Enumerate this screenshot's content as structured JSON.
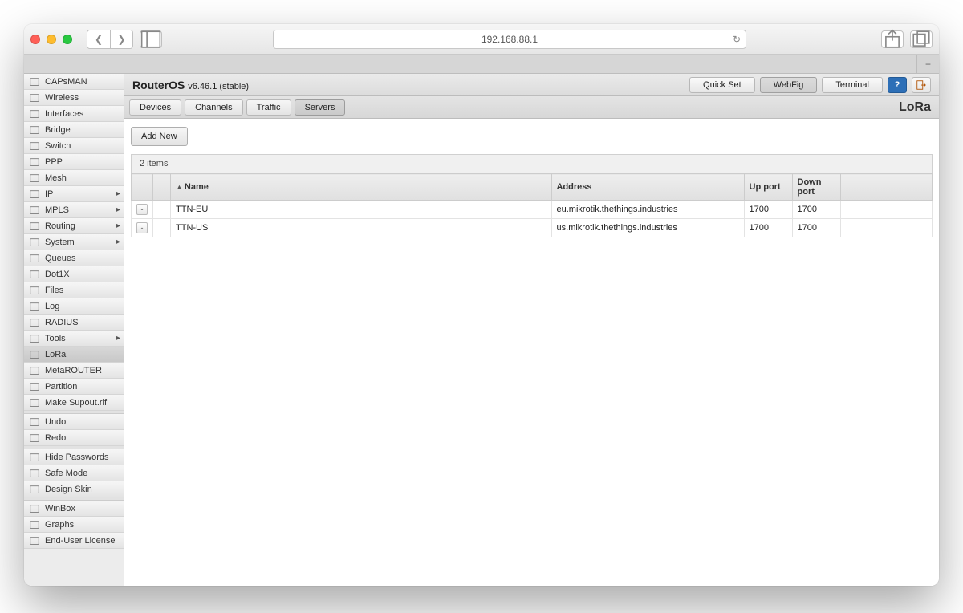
{
  "browser": {
    "url": "192.168.88.1"
  },
  "header": {
    "product": "RouterOS",
    "version_label": "v6.46.1 (stable)",
    "section": "LoRa",
    "modes": {
      "quickset": "Quick Set",
      "webfig": "WebFig",
      "terminal": "Terminal",
      "help": "?"
    }
  },
  "tabs": {
    "devices": "Devices",
    "channels": "Channels",
    "traffic": "Traffic",
    "servers": "Servers"
  },
  "toolbar": {
    "add_new": "Add New"
  },
  "table": {
    "count_label": "2 items",
    "columns": {
      "name": "Name",
      "address": "Address",
      "up_port": "Up port",
      "down_port": "Down port"
    },
    "rows": [
      {
        "name": "TTN-EU",
        "address": "eu.mikrotik.thethings.industries",
        "up_port": "1700",
        "down_port": "1700"
      },
      {
        "name": "TTN-US",
        "address": "us.mikrotik.thethings.industries",
        "up_port": "1700",
        "down_port": "1700"
      }
    ]
  },
  "sidebar": {
    "items": [
      {
        "label": "CAPsMAN",
        "submenu": false
      },
      {
        "label": "Wireless",
        "submenu": false
      },
      {
        "label": "Interfaces",
        "submenu": false
      },
      {
        "label": "Bridge",
        "submenu": false
      },
      {
        "label": "Switch",
        "submenu": false
      },
      {
        "label": "PPP",
        "submenu": false
      },
      {
        "label": "Mesh",
        "submenu": false
      },
      {
        "label": "IP",
        "submenu": true
      },
      {
        "label": "MPLS",
        "submenu": true
      },
      {
        "label": "Routing",
        "submenu": true
      },
      {
        "label": "System",
        "submenu": true
      },
      {
        "label": "Queues",
        "submenu": false
      },
      {
        "label": "Dot1X",
        "submenu": false
      },
      {
        "label": "Files",
        "submenu": false
      },
      {
        "label": "Log",
        "submenu": false
      },
      {
        "label": "RADIUS",
        "submenu": false
      },
      {
        "label": "Tools",
        "submenu": true
      },
      {
        "label": "LoRa",
        "submenu": false,
        "selected": true
      },
      {
        "label": "MetaROUTER",
        "submenu": false
      },
      {
        "label": "Partition",
        "submenu": false
      },
      {
        "label": "Make Supout.rif",
        "submenu": false
      }
    ],
    "items2": [
      {
        "label": "Undo"
      },
      {
        "label": "Redo"
      }
    ],
    "items3": [
      {
        "label": "Hide Passwords"
      },
      {
        "label": "Safe Mode"
      },
      {
        "label": "Design Skin"
      }
    ],
    "items4": [
      {
        "label": "WinBox"
      },
      {
        "label": "Graphs"
      },
      {
        "label": "End-User License"
      }
    ]
  }
}
